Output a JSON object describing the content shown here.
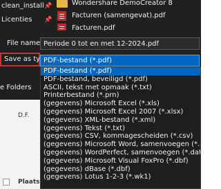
{
  "nav": {
    "items": [
      {
        "label": "clean_install",
        "pinned": true
      },
      {
        "label": "Licenties",
        "pinned": true
      }
    ]
  },
  "files": [
    {
      "name": "Wondershare DemoCreator 8",
      "type": "folder"
    },
    {
      "name": "Facturen (samengevat).pdf",
      "type": "pdf"
    },
    {
      "name": "Facturen.pdf",
      "type": "pdf"
    }
  ],
  "form": {
    "file_name_label": "File name:",
    "file_name_value": "Periode 0 tot en met 12-2024.pdf",
    "save_as_type_label": "Save as type:",
    "save_as_type_value": "PDF-bestand (*.pdf)"
  },
  "side": {
    "folders_label": "e Folders",
    "df_label": "D.F.",
    "plaats_label": "Plaats:"
  },
  "dropdown": {
    "options": [
      {
        "label": "PDF-bestand (*.pdf)",
        "selected": true
      },
      {
        "label": "PDF-bestand, beveiligd (*.pdf)"
      },
      {
        "label": "ASCII, tekst met opmaak (*.txt)"
      },
      {
        "label": "Printerbestand (*.prn)"
      },
      {
        "label": "(gegevens) Microsoft Excel (*.xls)"
      },
      {
        "label": "(gegevens) Microsoft Excel 2007 (*.xlsx)"
      },
      {
        "label": "(gegevens) XML-bestand (*.xml)"
      },
      {
        "label": "(gegevens) Tekst (*.txt)"
      },
      {
        "label": "(gegevens) CSV, kommagescheiden (*.csv)"
      },
      {
        "label": "(gegevens) Microsoft Word, samenvoegen (*.doc)"
      },
      {
        "label": "(gegevens) WordPerfect, samenvoegen (*.dat)"
      },
      {
        "label": "(gegevens) Microsoft Visual FoxPro (*.dbf)"
      },
      {
        "label": "(gegevens) dBase (*.dbf)"
      },
      {
        "label": "(gegevens) Lotus 1-2-3 (*.wk1)"
      }
    ]
  },
  "colors": {
    "accent": "#0067c0",
    "highlight_border": "#d32f2f",
    "dark_bg": "#202020"
  }
}
